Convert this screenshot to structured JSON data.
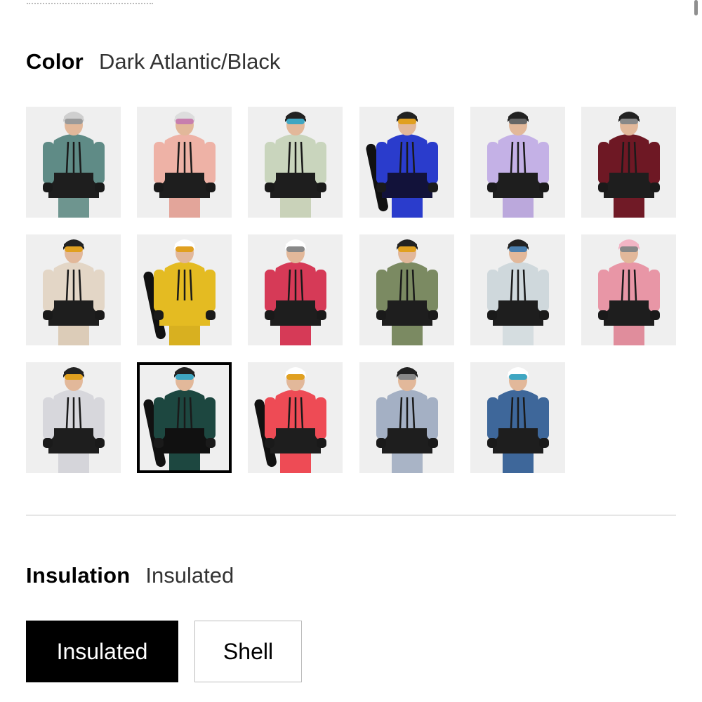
{
  "color_section": {
    "label": "Color",
    "selected_value": "Dark Atlantic/Black",
    "swatches": [
      {
        "top": "#5f8b86",
        "bottom": "#1e1e1e",
        "pants": "#6e958f",
        "helmet": "#cfcfcf",
        "goggle": "#9a9a9a",
        "board": ""
      },
      {
        "top": "#eeb2a6",
        "bottom": "#1e1e1e",
        "pants": "#e3a59a",
        "helmet": "#dddddd",
        "goggle": "#c77fae",
        "board": ""
      },
      {
        "top": "#c9d5bd",
        "bottom": "#1e1e1e",
        "pants": "#c9d2b9",
        "helmet": "#222222",
        "goggle": "#3fa6c2",
        "board": ""
      },
      {
        "top": "#2a3ccc",
        "bottom": "#12123a",
        "pants": "#2a3ccc",
        "helmet": "#222222",
        "goggle": "#e0a020",
        "board": "#111111"
      },
      {
        "top": "#c4b1e6",
        "bottom": "#1e1e1e",
        "pants": "#bba8dc",
        "helmet": "#222222",
        "goggle": "#666666",
        "board": ""
      },
      {
        "top": "#6e1824",
        "bottom": "#1e1e1e",
        "pants": "#701a26",
        "helmet": "#222222",
        "goggle": "#888888",
        "board": ""
      },
      {
        "top": "#e3d6c6",
        "bottom": "#1e1e1e",
        "pants": "#dcccb8",
        "helmet": "#222222",
        "goggle": "#e0a020",
        "board": ""
      },
      {
        "top": "#e4bb22",
        "bottom": "#e4bb22",
        "pants": "#d8b020",
        "helmet": "#ffffff",
        "goggle": "#e0a020",
        "board": "#111111"
      },
      {
        "top": "#d63a57",
        "bottom": "#1e1e1e",
        "pants": "#d63a57",
        "helmet": "#ffffff",
        "goggle": "#888888",
        "board": ""
      },
      {
        "top": "#7b8a62",
        "bottom": "#1e1e1e",
        "pants": "#7b8a62",
        "helmet": "#222222",
        "goggle": "#e0a020",
        "board": ""
      },
      {
        "top": "#cfd8dc",
        "bottom": "#1e1e1e",
        "pants": "#d5dde0",
        "helmet": "#222222",
        "goggle": "#4b7fae",
        "board": ""
      },
      {
        "top": "#e896a6",
        "bottom": "#1e1e1e",
        "pants": "#e08d9c",
        "helmet": "#f2b5c5",
        "goggle": "#888888",
        "board": ""
      },
      {
        "top": "#d7d7dc",
        "bottom": "#1e1e1e",
        "pants": "#d5d5da",
        "helmet": "#222222",
        "goggle": "#e0a020",
        "board": ""
      },
      {
        "top": "#1d4740",
        "bottom": "#111111",
        "pants": "#1d4740",
        "helmet": "#222222",
        "goggle": "#3fa6c2",
        "board": "#111111"
      },
      {
        "top": "#ee4b55",
        "bottom": "#1e1e1e",
        "pants": "#ee4b55",
        "helmet": "#ffffff",
        "goggle": "#e0a020",
        "board": "#111111"
      },
      {
        "top": "#a4b0c4",
        "bottom": "#1e1e1e",
        "pants": "#a9b4c6",
        "helmet": "#222222",
        "goggle": "#888888",
        "board": ""
      },
      {
        "top": "#3e679a",
        "bottom": "#1e1e1e",
        "pants": "#3e679a",
        "helmet": "#ffffff",
        "goggle": "#3fa6c2",
        "board": ""
      }
    ],
    "selected_index": 13
  },
  "insulation_section": {
    "label": "Insulation",
    "selected_value": "Insulated",
    "options": {
      "insulated": "Insulated",
      "shell": "Shell"
    }
  }
}
